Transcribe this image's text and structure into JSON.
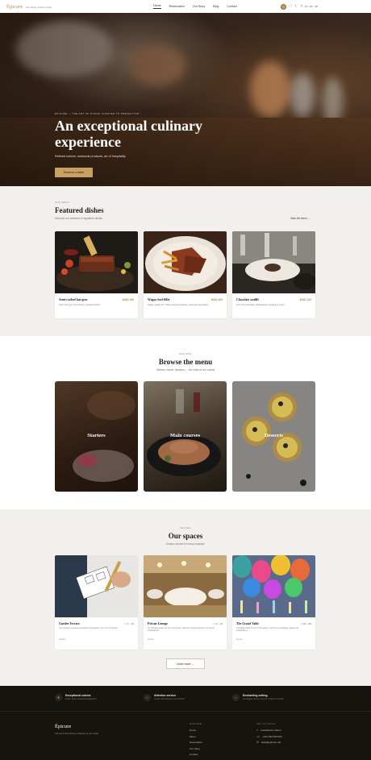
{
  "header": {
    "brand": "Épicure",
    "tagline": "Fine dining, creative cuisine",
    "nav": [
      "Home",
      "Reservation",
      "Our Story",
      "Blog",
      "Contact"
    ],
    "icons": [
      "avatar",
      "heart-icon",
      "moon-icon",
      "globe-icon"
    ],
    "languages": [
      "FR",
      "EN",
      "AR"
    ]
  },
  "hero": {
    "kicker": "ÉPICURE — THE ART OF DINING CURATED TO PERFECTION",
    "title": "An exceptional culinary experience",
    "subtitle": "Refined cuisine, seasonal products, art of hospitality",
    "cta": "Reserve a table"
  },
  "featured": {
    "kicker": "OUR MENU",
    "title": "Featured dishes",
    "subtitle": "Discover our selection of signature dishes",
    "view_all": "View full menu →",
    "dishes": [
      {
        "name": "Semi-cooked foie gras",
        "price": "MAD 190",
        "desc": "Duck foie gras, fig chutney, toasted brioche"
      },
      {
        "name": "Wagyu beef fillet",
        "price": "MAD 450",
        "desc": "Wagyu grade A5, truffle mashed potatoes, seasonal vegetables"
      },
      {
        "name": "Chocolate soufflé",
        "price": "MAD 120",
        "desc": "Hot 70% chocolate, Madagascar vanilla ice cream"
      }
    ]
  },
  "browse": {
    "kicker": "EXPLORE",
    "title": "Browse the menu",
    "subtitle": "Starters, mains, desserts — the heart of our cuisine",
    "categories": [
      "Starters",
      "Main courses",
      "Desserts"
    ]
  },
  "spaces": {
    "kicker": "SPACES",
    "title": "Our spaces",
    "subtitle": "Unique venues for every occasion",
    "items": [
      {
        "name": "Garden Terrace",
        "cap": "4 – 16",
        "desc": "Our outdoor terrace overlooking the gardens, for 4 to 16 people.",
        "tag": "Outdoor"
      },
      {
        "name": "Private Lounge",
        "cap": "8 – 12",
        "desc": "An intimate space for 8 to 12 guests, ideal for business dinners or family celebrations.",
        "tag": "Private"
      },
      {
        "name": "The Grand Table",
        "cap": "20 – 50",
        "desc": "Our large table for 20 to 50 guests, perfect for weddings, galas and celebrations.",
        "tag": "Events"
      }
    ],
    "cta": "Learn more →"
  },
  "footer": {
    "features": [
      {
        "icon": "leaf-icon",
        "title": "Exceptional cuisine",
        "sub": "Fresh, local, seasonal ingredients"
      },
      {
        "icon": "star-icon",
        "title": "Attentive service",
        "sub": "A team dedicated to your comfort"
      },
      {
        "icon": "home-icon",
        "title": "Enchanting setting",
        "sub": "An elegant dining room for unique moments"
      }
    ],
    "brand": "Épicure",
    "tagline": "The art of fine dining, creativity in your plate",
    "explore_head": "EXPLORE",
    "explore": [
      "Home",
      "Menu",
      "Reservation",
      "Our Story",
      "Contact"
    ],
    "contact_head": "GET IN TOUCH",
    "contact": [
      "Casablanca, Maroc",
      "+212 522 000 000",
      "hello@epicure.ma"
    ]
  }
}
